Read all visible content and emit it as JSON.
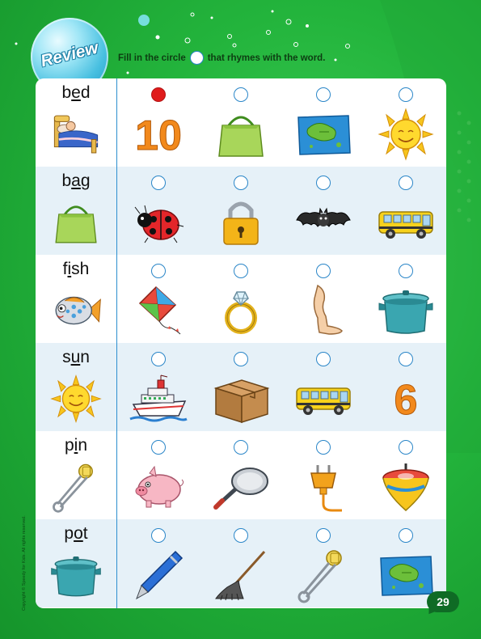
{
  "header": {
    "badge": "Review",
    "instruction_before": "Fill in the circle",
    "instruction_after": "that rhymes with the word."
  },
  "rows": [
    {
      "word_pre": "b",
      "word_mid": "e",
      "word_post": "d",
      "cue": "bed-icon",
      "options": [
        {
          "icon": "number-10-icon",
          "text": "10",
          "selected": true
        },
        {
          "icon": "bag-icon",
          "selected": false
        },
        {
          "icon": "map-icon",
          "selected": false
        },
        {
          "icon": "sun-icon",
          "selected": false
        }
      ]
    },
    {
      "word_pre": "b",
      "word_mid": "a",
      "word_post": "g",
      "cue": "bag-icon",
      "options": [
        {
          "icon": "ladybug-icon",
          "selected": false
        },
        {
          "icon": "padlock-icon",
          "selected": false
        },
        {
          "icon": "bat-icon",
          "selected": false
        },
        {
          "icon": "bus-icon",
          "selected": false
        }
      ]
    },
    {
      "word_pre": "f",
      "word_mid": "i",
      "word_post": "sh",
      "cue": "fish-icon",
      "options": [
        {
          "icon": "kite-icon",
          "selected": false
        },
        {
          "icon": "ring-icon",
          "selected": false
        },
        {
          "icon": "leg-icon",
          "selected": false
        },
        {
          "icon": "pot-icon",
          "selected": false
        }
      ]
    },
    {
      "word_pre": "s",
      "word_mid": "u",
      "word_post": "n",
      "cue": "sun-icon",
      "options": [
        {
          "icon": "ship-icon",
          "selected": false
        },
        {
          "icon": "box-icon",
          "selected": false
        },
        {
          "icon": "bus-icon",
          "selected": false
        },
        {
          "icon": "number-6-icon",
          "text": "6",
          "selected": false
        }
      ]
    },
    {
      "word_pre": "p",
      "word_mid": "i",
      "word_post": "n",
      "cue": "safety-pin-icon",
      "options": [
        {
          "icon": "pig-icon",
          "selected": false
        },
        {
          "icon": "frying-pan-icon",
          "selected": false
        },
        {
          "icon": "plug-icon",
          "selected": false
        },
        {
          "icon": "spinning-top-icon",
          "selected": false
        }
      ]
    },
    {
      "word_pre": "p",
      "word_mid": "o",
      "word_post": "t",
      "cue": "pot-icon",
      "options": [
        {
          "icon": "pen-icon",
          "selected": false
        },
        {
          "icon": "mop-icon",
          "selected": false
        },
        {
          "icon": "safety-pin-icon",
          "selected": false
        },
        {
          "icon": "map-icon",
          "selected": false
        }
      ]
    }
  ],
  "footer": {
    "copyright": "Copyright © Speedy for Kids. All rights reserved.",
    "page_number": "29"
  }
}
